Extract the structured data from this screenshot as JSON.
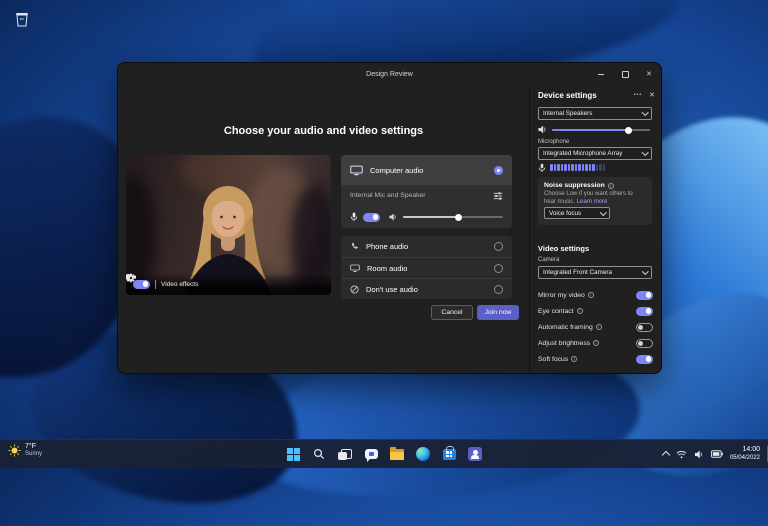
{
  "colors": {
    "accent": "#7f85f5",
    "join_button": "#5b5fc7",
    "wallpaper_accent": "#2e7bd9"
  },
  "taskbar": {
    "weather": {
      "temperature": "7°F",
      "condition": "Sunny"
    },
    "icons": [
      {
        "name": "start"
      },
      {
        "name": "search"
      },
      {
        "name": "task-view"
      },
      {
        "name": "chat"
      },
      {
        "name": "file-explorer"
      },
      {
        "name": "edge"
      },
      {
        "name": "store"
      },
      {
        "name": "teams"
      }
    ],
    "tray": {
      "time": "14:00",
      "date": "05/04/2022"
    }
  },
  "window": {
    "title": "Design Review",
    "heading": "Choose your audio and video settings",
    "preview": {
      "video_effects_label": "Video effects",
      "camera_on": true
    },
    "audio": {
      "computer_audio_label": "Computer audio",
      "computer_audio_selected": true,
      "device_line": "Internal Mic and Speaker",
      "mic_on": true,
      "options": [
        {
          "label": "Phone audio",
          "selected": false
        },
        {
          "label": "Room audio",
          "selected": false
        },
        {
          "label": "Don't use audio",
          "selected": false
        }
      ]
    },
    "levels": {
      "main_volume": 55,
      "speaker_volume": 78
    },
    "footer": {
      "cancel": "Cancel",
      "join": "Join now"
    }
  },
  "device_settings": {
    "title": "Device settings",
    "speaker_value": "Internal Speakers",
    "microphone_label": "Microphone",
    "microphone_value": "Integrated Microphone Array",
    "mic_meter": {
      "bars": 16,
      "filled": 13
    },
    "noise_suppression": {
      "title": "Noise suppression",
      "description": "Choose Low if you want others to hear music.",
      "link": "Learn more",
      "value": "Voice focus"
    },
    "video_settings_title": "Video settings",
    "camera_label": "Camera",
    "camera_value": "Integrated Front Camera",
    "toggles": [
      {
        "label": "Mirror my video",
        "on": true
      },
      {
        "label": "Eye contact",
        "on": true
      },
      {
        "label": "Automatic framing",
        "on": false
      },
      {
        "label": "Adjust brightness",
        "on": false
      },
      {
        "label": "Soft focus",
        "on": true
      }
    ]
  }
}
